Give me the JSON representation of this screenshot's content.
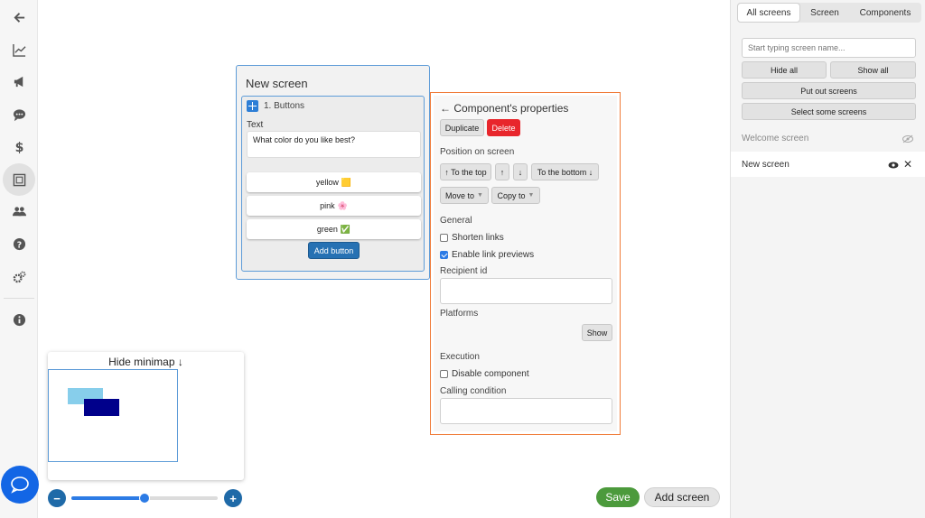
{
  "rail": {
    "icons": [
      "back-arrow-icon",
      "chart-icon",
      "megaphone-icon",
      "chat-bubble-icon",
      "dollar-icon",
      "screens-icon",
      "users-icon",
      "help-icon",
      "settings-icon",
      "info-icon"
    ]
  },
  "screen_card": {
    "title": "New screen",
    "component_title": "1. Buttons",
    "text_label": "Text",
    "text_value": "What  color do you like best?",
    "buttons": [
      {
        "label": "yellow",
        "emoji": "🟨"
      },
      {
        "label": "pink",
        "emoji": "🌸"
      },
      {
        "label": "green",
        "emoji": "✅"
      }
    ],
    "add_button_label": "Add button"
  },
  "properties": {
    "title": "Component's properties",
    "back_arrow": "←",
    "duplicate_label": "Duplicate",
    "delete_label": "Delete",
    "position_heading": "Position on screen",
    "to_top_label": "↑ To the top",
    "up_label": "↑",
    "down_label": "↓",
    "to_bottom_label": "To the bottom ↓",
    "move_to_label": "Move to",
    "copy_to_label": "Copy to",
    "caret": "▼",
    "general_heading": "General",
    "shorten_links_label": "Shorten links",
    "shorten_links_checked": false,
    "link_previews_label": "Enable link previews",
    "link_previews_checked": true,
    "recipient_label": "Recipient id",
    "recipient_value": "",
    "platforms_label": "Platforms",
    "show_label": "Show",
    "execution_heading": "Execution",
    "disable_label": "Disable component",
    "disable_checked": false,
    "condition_label": "Calling condition",
    "condition_value": ""
  },
  "minimap": {
    "title": "Hide minimap ↓",
    "colors": {
      "block_a": "#87ceeb",
      "block_b": "#00008b"
    }
  },
  "zoom": {
    "minus": "−",
    "plus": "+",
    "level_fraction": 0.5
  },
  "footer": {
    "save_label": "Save",
    "add_screen_label": "Add screen"
  },
  "sidebar": {
    "tabs": [
      "All screens",
      "Screen",
      "Components"
    ],
    "active_tab": "All screens",
    "search_placeholder": "Start typing screen name...",
    "hide_all_label": "Hide all",
    "show_all_label": "Show all",
    "put_out_label": "Put out screens",
    "select_some_label": "Select some screens",
    "screens": [
      {
        "name": "Welcome screen",
        "hidden": true
      },
      {
        "name": "New screen",
        "hidden": false,
        "close": "✕"
      }
    ]
  },
  "colors": {
    "accent_blue": "#2c7be5",
    "selection_orange": "#f07c3a",
    "danger_red": "#e8262c",
    "save_green": "#4c9a3c"
  }
}
